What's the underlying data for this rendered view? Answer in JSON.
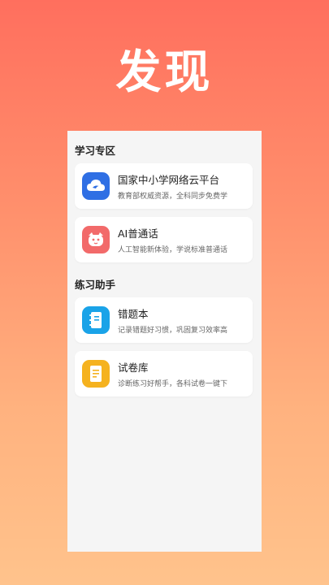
{
  "page": {
    "title": "发现"
  },
  "sections": [
    {
      "title": "学习专区",
      "items": [
        {
          "title": "国家中小学网络云平台",
          "desc": "教育部权威资源，全科同步免费学",
          "icon": "cloud-icon",
          "color": "#2f6fe4"
        },
        {
          "title": "AI普通话",
          "desc": "人工智能新体验，学说标准普通话",
          "icon": "mascot-icon",
          "color": "#f26a6a"
        }
      ]
    },
    {
      "title": "练习助手",
      "items": [
        {
          "title": "错题本",
          "desc": "记录错题好习惯，巩固复习效率高",
          "icon": "notebook-icon",
          "color": "#1aa3e8"
        },
        {
          "title": "试卷库",
          "desc": "诊断练习好帮手，各科试卷一键下",
          "icon": "document-icon",
          "color": "#f5b21f"
        }
      ]
    }
  ]
}
